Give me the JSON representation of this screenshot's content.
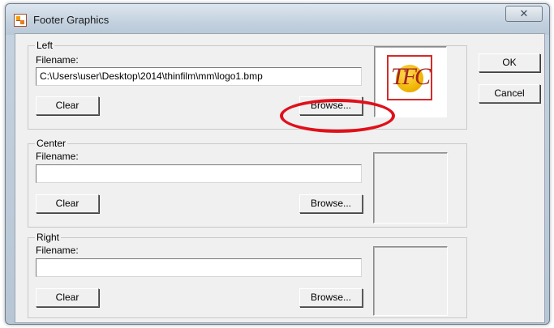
{
  "window": {
    "title": "Footer Graphics",
    "close_glyph": "✕"
  },
  "left": {
    "group_label": "Left",
    "filename_label": "Filename:",
    "filename_value": "C:\\Users\\user\\Desktop\\2014\\thinfilm\\mm\\logo1.bmp",
    "clear_label": "Clear",
    "browse_label": "Browse...",
    "logo_text": "TFC"
  },
  "center": {
    "group_label": "Center",
    "filename_label": "Filename:",
    "filename_value": "",
    "clear_label": "Clear",
    "browse_label": "Browse..."
  },
  "right": {
    "group_label": "Right",
    "filename_label": "Filename:",
    "filename_value": "",
    "clear_label": "Clear",
    "browse_label": "Browse..."
  },
  "actions": {
    "ok_label": "OK",
    "cancel_label": "Cancel"
  },
  "colors": {
    "highlight": "#e0101a",
    "logo_border": "#d62a2a",
    "logo_circle": "#f2b705"
  },
  "icons": {
    "app": "footer-graphics-app-icon",
    "close": "close-icon"
  }
}
